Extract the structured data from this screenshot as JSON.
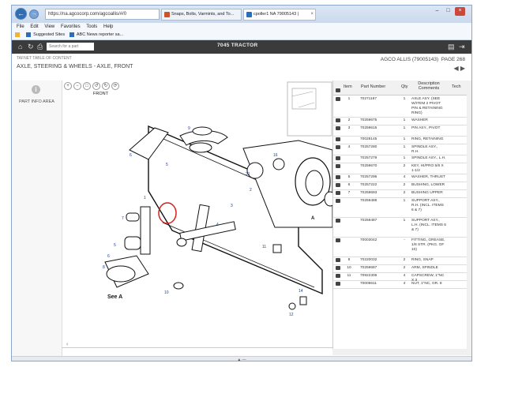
{
  "browser": {
    "address": "https://na.agcocorp.com/agcoallis/#/0",
    "tabs": [
      {
        "label": "Snaps, Bolts, Varmints, and To..."
      },
      {
        "label": "cpoller1 NA  79005143 |"
      }
    ],
    "menu": [
      "File",
      "Edit",
      "View",
      "Favorites",
      "Tools",
      "Help"
    ],
    "favorites": [
      "Suggested Sites",
      "ABC News reporter sa..."
    ]
  },
  "app": {
    "search_placeholder": "Search for a part",
    "title": "7045 TRACTOR",
    "breadcrumb": "TAFNET TABLE OF CONTENT",
    "section": "AXLE, STEERING & WHEELS - AXLE, FRONT",
    "catalog": "AGCO ALLIS (79005143)",
    "page": "PAGE 268",
    "left_panel_label": "PART INFO AREA",
    "diagram_label_front": "FRONT",
    "diagram_label_seeA": "See A",
    "diagram_label_A": "A"
  },
  "table": {
    "headers": [
      "Item",
      "Part Number",
      "Qty",
      "Description Comments",
      "Tech"
    ],
    "rows": [
      {
        "item": "1",
        "part": "70271187",
        "qty": "1",
        "desc": "AXLE ASY. (SEE W/ITEM 2 PIVOT PIN & RETAINING RING)"
      },
      {
        "item": "2",
        "part": "70259675",
        "qty": "1",
        "desc": "WASHER"
      },
      {
        "item": "3",
        "part": "70259615",
        "qty": "1",
        "desc": "PIN ASY., PIVOT"
      },
      {
        "item": "",
        "part": "70028145",
        "qty": "1",
        "desc": "RING, RETAINING"
      },
      {
        "item": "4",
        "part": "70257280",
        "qty": "1",
        "desc": "SPINDLE ASY., R.H."
      },
      {
        "item": "",
        "part": "70257279",
        "qty": "1",
        "desc": "SPINDLE ASY., L.H."
      },
      {
        "item": "",
        "part": "70259670",
        "qty": "2",
        "desc": "KEY, HI/PRO 5/8 X 1-1/2"
      },
      {
        "item": "5",
        "part": "70257296",
        "qty": "4",
        "desc": "WASHER, THRUST"
      },
      {
        "item": "6",
        "part": "70257222",
        "qty": "2",
        "desc": "BUSHING, LOWER"
      },
      {
        "item": "7",
        "part": "70259693",
        "qty": "2",
        "desc": "BUSHING UPPER"
      },
      {
        "item": "",
        "part": "70259486",
        "qty": "1",
        "desc": "SUPPORT ASY., R.H. (INCL. ITEMS 6 & 7)"
      },
      {
        "item": "",
        "part": "70259487",
        "qty": "1",
        "desc": "SUPPORT ASY., L.H. (INCL. ITEMS 6 & 7)"
      },
      {
        "item": "",
        "part": "70003042",
        "qty": "-",
        "desc": "FITTING, GREASE, 1/8 STR. (PKG. OF 10)"
      },
      {
        "item": "8",
        "part": "70220032",
        "qty": "2",
        "desc": "RING, SNAP"
      },
      {
        "item": "10",
        "part": "70259687",
        "qty": "2",
        "desc": "ARM, SPINDLE"
      },
      {
        "item": "11",
        "part": "70922306",
        "qty": "4",
        "desc": "CAPSCREW, 1\"NC X 3"
      },
      {
        "item": "",
        "part": "70009611",
        "qty": "4",
        "desc": "NUT, 1\"NC, GR. 8"
      }
    ]
  },
  "status_text": "▲ —"
}
